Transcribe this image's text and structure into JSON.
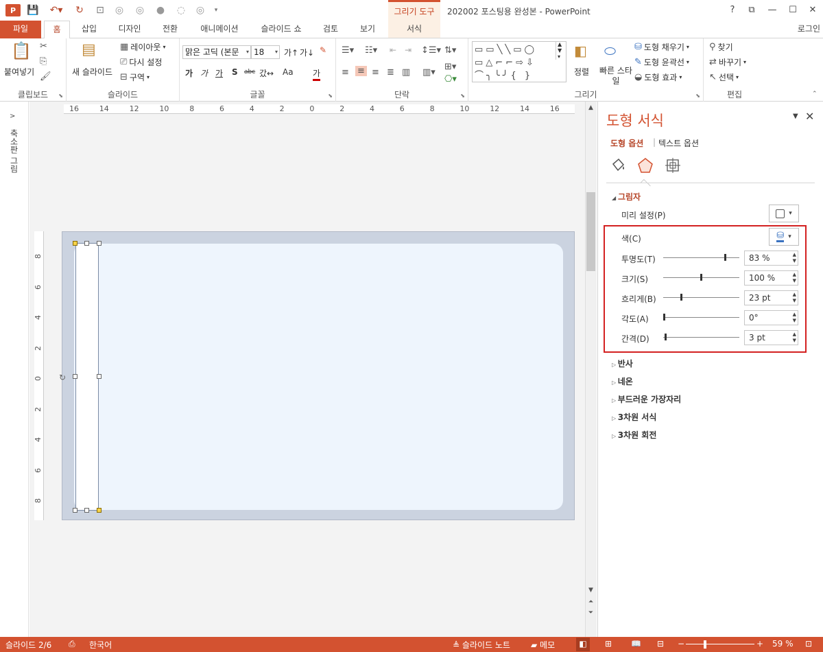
{
  "app": {
    "title": "202002 포스팅용 완성본 - PowerPoint",
    "context_group": "그리기 도구"
  },
  "titlebar": {
    "help": "?",
    "restore": "⧉",
    "minimize": "—",
    "maximize": "☐",
    "close": "✕"
  },
  "tabs": [
    "파일",
    "홈",
    "삽입",
    "디자인",
    "전환",
    "애니메이션",
    "슬라이드 쇼",
    "검토",
    "보기",
    "서식"
  ],
  "login": "로그인",
  "ribbon": {
    "clipboard": {
      "label": "클립보드",
      "paste": "붙여넣기"
    },
    "slides": {
      "label": "슬라이드",
      "new_slide": "새 슬라이드",
      "layout": "레이아웃",
      "reset": "다시 설정",
      "section": "구역"
    },
    "font": {
      "label": "글꼴",
      "font_name": "맑은 고딕 (본문",
      "font_size": "18",
      "bold": "가",
      "italic": "가",
      "underline": "가",
      "shadow": "S",
      "strike": "abc",
      "spacing": "갔↔",
      "case": "Aa",
      "color": "가"
    },
    "paragraph": {
      "label": "단락"
    },
    "drawing": {
      "label": "그리기",
      "arrange": "정렬",
      "quick_styles": "빠른 스타일",
      "fill": "도형 채우기",
      "outline": "도형 윤곽선",
      "effects": "도형 효과"
    },
    "editing": {
      "label": "편집",
      "find": "찾기",
      "replace": "바꾸기",
      "select": "선택"
    }
  },
  "left_pane": {
    "label": "축소판 그림"
  },
  "rulers": {
    "h_ticks": [
      "16",
      "14",
      "12",
      "10",
      "8",
      "6",
      "4",
      "2",
      "0",
      "2",
      "4",
      "6",
      "8",
      "10",
      "12",
      "14",
      "16"
    ],
    "v_ticks": [
      "8",
      "6",
      "4",
      "2",
      "0",
      "2",
      "4",
      "6",
      "8"
    ]
  },
  "panel": {
    "title": "도형 서식",
    "tab_shape": "도형 옵션",
    "tab_text": "텍스트 옵션",
    "section_shadow": "그림자",
    "preset": "미리 설정(P)",
    "color": "색(C)",
    "transparency": {
      "label": "투명도(T)",
      "value": "83 %",
      "level": 0.83
    },
    "size": {
      "label": "크기(S)",
      "value": "100 %",
      "level": 0.5
    },
    "blur": {
      "label": "흐리게(B)",
      "value": "23 pt",
      "level": 0.23
    },
    "angle": {
      "label": "각도(A)",
      "value": "0°",
      "level": 0.0
    },
    "distance": {
      "label": "간격(D)",
      "value": "3 pt",
      "level": 0.02
    },
    "collapsed": [
      "반사",
      "네온",
      "부드러운 가장자리",
      "3차원 서식",
      "3차원 회전"
    ]
  },
  "status": {
    "slide": "슬라이드 2/6",
    "language": "한국어",
    "notes": "슬라이드 노트",
    "comments": "메모",
    "zoom": "59 %",
    "zoom_minus": "−",
    "zoom_plus": "+"
  },
  "colors": {
    "accent": "#D35230",
    "highlight": "#D32020"
  }
}
